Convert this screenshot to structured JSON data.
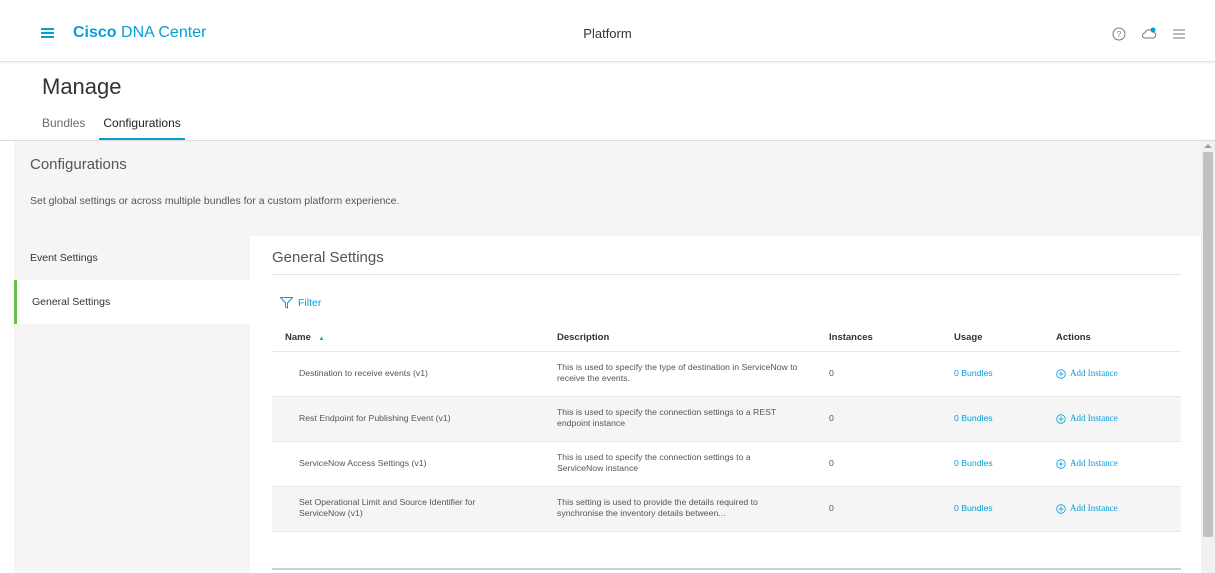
{
  "header": {
    "brand_bold": "Cisco",
    "brand_rest": " DNA Center",
    "center_title": "Platform",
    "icons": [
      "help-icon",
      "cloud-notification-icon",
      "menu-list-icon"
    ]
  },
  "page": {
    "title": "Manage",
    "tabs": [
      {
        "label": "Bundles",
        "active": false
      },
      {
        "label": "Configurations",
        "active": true
      }
    ]
  },
  "configurations": {
    "title": "Configurations",
    "description": "Set global settings or across multiple bundles for a custom platform experience."
  },
  "sidebar": {
    "items": [
      {
        "label": "Event Settings",
        "selected": false
      },
      {
        "label": "General Settings",
        "selected": true
      }
    ]
  },
  "main": {
    "title": "General Settings",
    "filter_label": "Filter",
    "columns": [
      "Name",
      "Description",
      "Instances",
      "Usage",
      "Actions"
    ],
    "sort_indicator": "▲",
    "rows": [
      {
        "name": "Destination to receive events (v1)",
        "description": "This is used to specify the type of destination in ServiceNow to receive the events.",
        "instances": "0",
        "usage": "0 Bundles",
        "action": "Add Instance"
      },
      {
        "name": "Rest Endpoint for Publishing Event (v1)",
        "description": "This is used to specify the connection settings to a REST endpoint instance",
        "instances": "0",
        "usage": "0 Bundles",
        "action": "Add Instance"
      },
      {
        "name": "ServiceNow Access Settings (v1)",
        "description": "This is used to specify the connection settings to a ServiceNow instance",
        "instances": "0",
        "usage": "0 Bundles",
        "action": "Add Instance"
      },
      {
        "name": "Set Operational Limit and Source Identifier for ServiceNow (v1)",
        "description": "This setting is used to provide the details required to synchronise the inventory details between...",
        "instances": "0",
        "usage": "0 Bundles",
        "action": "Add Instance"
      }
    ]
  },
  "colors": {
    "accent": "#049fd9",
    "selected_marker": "#6cc04a",
    "panel_bg": "#f5f5f5"
  }
}
